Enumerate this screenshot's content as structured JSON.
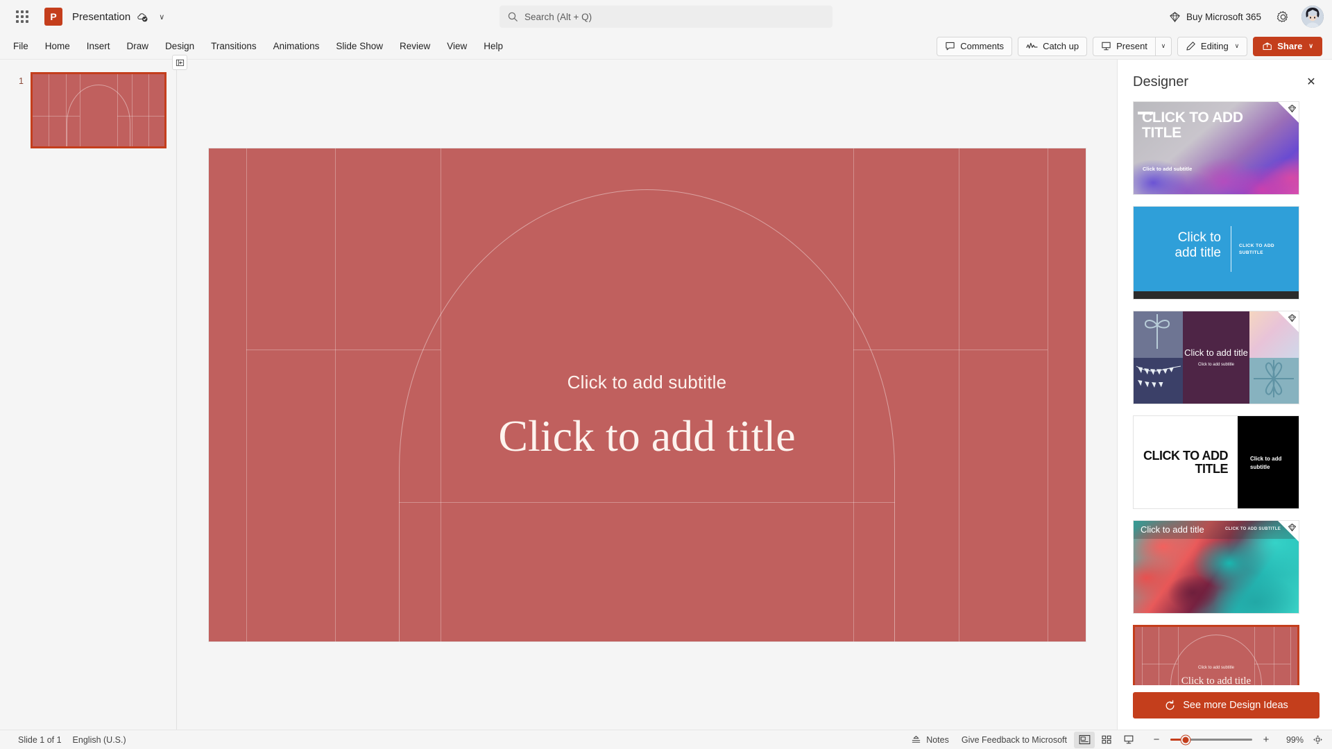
{
  "titlebar": {
    "app_launcher": "app-launcher",
    "app_icon_letter": "P",
    "document_title": "Presentation",
    "saved_status": "saved-to-cloud",
    "title_chevron": "∨",
    "search_placeholder": "Search (Alt + Q)",
    "buy_label": "Buy Microsoft 365",
    "settings": "settings",
    "account": "account"
  },
  "ribbon": {
    "tabs": [
      {
        "label": "File"
      },
      {
        "label": "Home"
      },
      {
        "label": "Insert"
      },
      {
        "label": "Draw"
      },
      {
        "label": "Design"
      },
      {
        "label": "Transitions"
      },
      {
        "label": "Animations"
      },
      {
        "label": "Slide Show"
      },
      {
        "label": "Review"
      },
      {
        "label": "View"
      },
      {
        "label": "Help"
      }
    ],
    "comments_label": "Comments",
    "catchup_label": "Catch up",
    "present_label": "Present",
    "editing_label": "Editing",
    "share_label": "Share",
    "caret": "∨"
  },
  "thumbnails": {
    "slides": [
      {
        "number": "1"
      }
    ],
    "collapse_tooltip": "collapse-pane"
  },
  "slide": {
    "subtitle": "Click to add subtitle",
    "title": "Click to add title",
    "background_color": "#c0605e",
    "text_color": "#fdf3ee"
  },
  "designer": {
    "title": "Designer",
    "close_label": "✕",
    "see_more_label": "See more Design Ideas",
    "cards": [
      {
        "id": "watercolor",
        "title": "CLICK TO ADD TITLE",
        "subtitle": "Click to add subtitle",
        "premium": true
      },
      {
        "id": "blue-divider",
        "title": "Click to add title",
        "subtitle": "CLICK TO ADD SUBTITLE",
        "premium": false
      },
      {
        "id": "celebration-collage",
        "title": "Click to add title",
        "subtitle": "Click to add subtitle",
        "premium": true
      },
      {
        "id": "bold-black-white",
        "title": "CLICK TO ADD TITLE",
        "subtitle": "Click to add subtitle",
        "premium": false
      },
      {
        "id": "teal-coral-marble",
        "title": "Click to add title",
        "subtitle": "CLICK TO ADD SUBTITLE",
        "premium": true
      },
      {
        "id": "terracotta-arch",
        "title": "Click to add title",
        "subtitle": "Click to add subtitle",
        "premium": false,
        "selected": true
      }
    ]
  },
  "statusbar": {
    "slide_count": "Slide 1 of 1",
    "language": "English (U.S.)",
    "notes_label": "Notes",
    "feedback_label": "Give Feedback to Microsoft",
    "view_normal": "normal-view",
    "view_sorter": "slide-sorter-view",
    "view_reading": "reading-view",
    "zoom_out": "−",
    "zoom_in": "+",
    "zoom_level": "99%",
    "fit_label": "fit-to-window"
  },
  "colors": {
    "accent": "#c43e1c",
    "slide_bg": "#c0605e",
    "chrome_bg": "#f5f5f5"
  }
}
